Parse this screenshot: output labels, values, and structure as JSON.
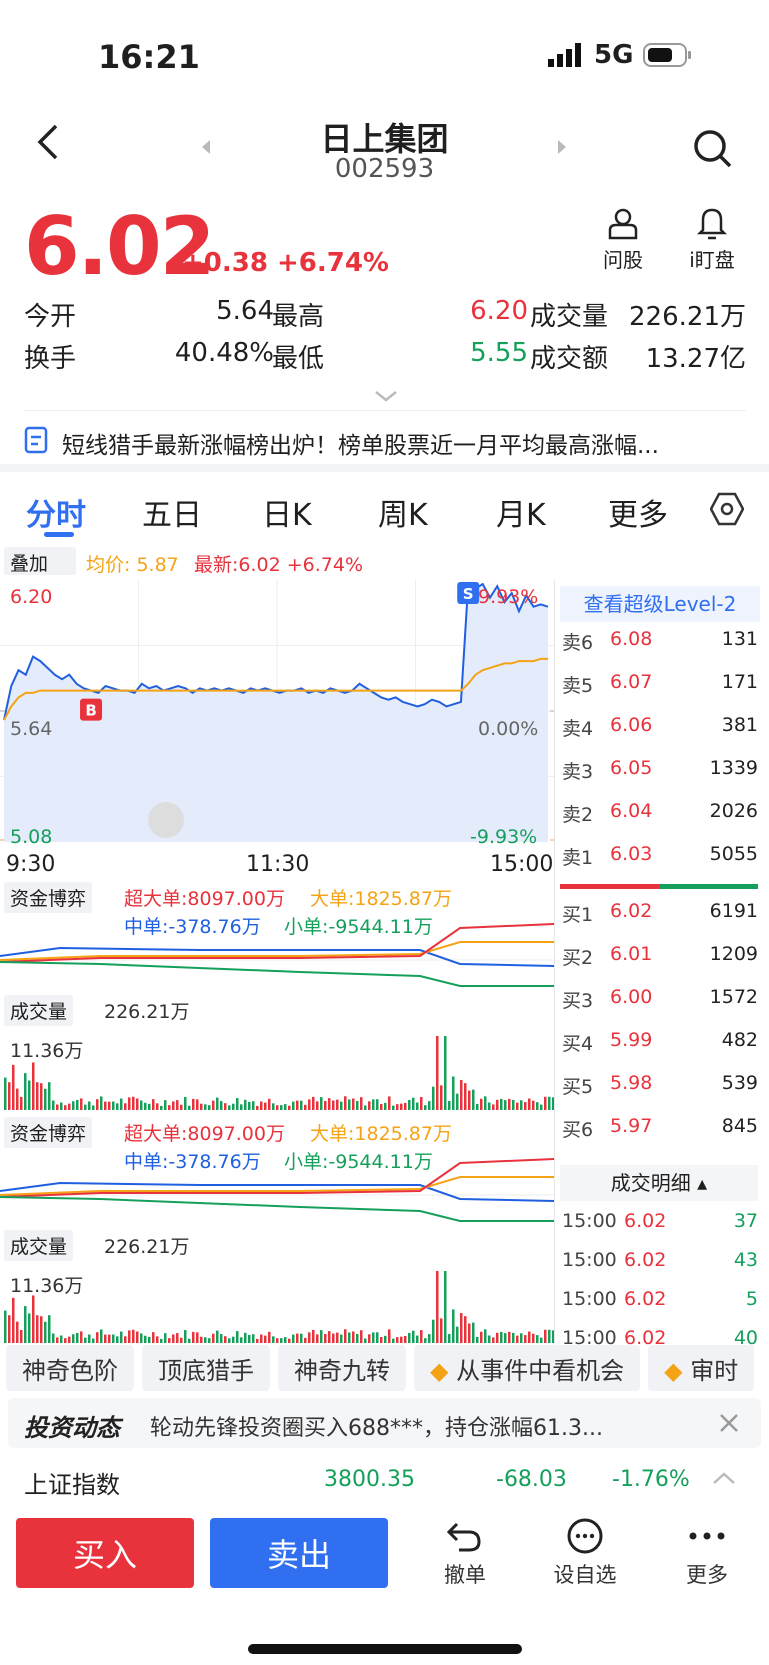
{
  "status": {
    "time": "16:21",
    "network": "5G"
  },
  "header": {
    "title": "日上集团",
    "code": "002593"
  },
  "quote": {
    "price": "6.02",
    "change": "+0.38",
    "change_pct": "+6.74%",
    "actions": [
      {
        "label": "问股",
        "icon": "person-icon"
      },
      {
        "label": "i盯盘",
        "icon": "bell-icon"
      }
    ],
    "rows": [
      [
        {
          "label": "今开",
          "value": "5.64"
        },
        {
          "label": "最高",
          "value": "6.20"
        },
        {
          "label": "成交量",
          "value": "226.21万"
        }
      ],
      [
        {
          "label": "换手",
          "value": "40.48%"
        },
        {
          "label": "最低",
          "value": "5.55"
        },
        {
          "label": "成交额",
          "value": "13.27亿"
        }
      ]
    ]
  },
  "news": "短线猎手最新涨幅榜出炉！榜单股票近一月平均最高涨幅...",
  "tabs": [
    "分时",
    "五日",
    "日K",
    "周K",
    "月K",
    "更多"
  ],
  "chart_header": {
    "overlay": "叠加",
    "avg": "均价: 5.87",
    "latest": "最新:6.02 +6.74%"
  },
  "chart_data": {
    "type": "line",
    "x_ticks": [
      "9:30",
      "11:30",
      "15:00"
    ],
    "y_left": [
      "6.20",
      "5.64",
      "5.08"
    ],
    "y_right": [
      "9.93%",
      "0.00%",
      "-9.93%"
    ],
    "ylim": [
      5.08,
      6.2
    ],
    "series": [
      {
        "name": "最新",
        "values": [
          5.6,
          5.75,
          5.82,
          5.8,
          5.88,
          5.86,
          5.83,
          5.8,
          5.78,
          5.8,
          5.76,
          5.74,
          5.73,
          5.72,
          5.75,
          5.74,
          5.73,
          5.73,
          5.72,
          5.76,
          5.74,
          5.75,
          5.73,
          5.74,
          5.75,
          5.74,
          5.72,
          5.74,
          5.73,
          5.74,
          5.73,
          5.74,
          5.73,
          5.72,
          5.74,
          5.73,
          5.74,
          5.73,
          5.72,
          5.73,
          5.73,
          5.74,
          5.72,
          5.73,
          5.72,
          5.74,
          5.73,
          5.72,
          5.73,
          5.76,
          5.74,
          5.72,
          5.7,
          5.69,
          5.7,
          5.68,
          5.67,
          5.66,
          5.67,
          5.69,
          5.68,
          5.66,
          5.67,
          5.68,
          6.2,
          6.18,
          6.2,
          6.14,
          6.19,
          6.12,
          6.16,
          6.08,
          6.15,
          6.1,
          6.11,
          6.1
        ]
      },
      {
        "name": "均价",
        "values": [
          5.6,
          5.66,
          5.7,
          5.72,
          5.72,
          5.73,
          5.73,
          5.73,
          5.73,
          5.73,
          5.73,
          5.73,
          5.73,
          5.73,
          5.73,
          5.73,
          5.73,
          5.73,
          5.73,
          5.73,
          5.73,
          5.73,
          5.73,
          5.73,
          5.73,
          5.73,
          5.73,
          5.73,
          5.73,
          5.73,
          5.73,
          5.73,
          5.73,
          5.73,
          5.73,
          5.73,
          5.73,
          5.73,
          5.73,
          5.73,
          5.73,
          5.73,
          5.73,
          5.73,
          5.73,
          5.73,
          5.73,
          5.73,
          5.73,
          5.73,
          5.73,
          5.73,
          5.73,
          5.73,
          5.73,
          5.73,
          5.73,
          5.73,
          5.73,
          5.73,
          5.73,
          5.73,
          5.73,
          5.73,
          5.76,
          5.8,
          5.82,
          5.83,
          5.84,
          5.85,
          5.85,
          5.86,
          5.86,
          5.86,
          5.87,
          5.87
        ]
      }
    ],
    "markers": [
      "B",
      "S"
    ]
  },
  "capital": {
    "title": "资金博弈",
    "super": "超大单:8097.00万",
    "big": "大单:1825.87万",
    "mid": "中单:-378.76万",
    "small": "小单:-9544.11万"
  },
  "volume": {
    "title": "成交量",
    "total": "226.21万",
    "max": "11.36万"
  },
  "orderbook": {
    "level2": "查看超级Level-2",
    "asks": [
      {
        "label": "卖6",
        "price": "6.08",
        "vol": "131"
      },
      {
        "label": "卖5",
        "price": "6.07",
        "vol": "171"
      },
      {
        "label": "卖4",
        "price": "6.06",
        "vol": "381"
      },
      {
        "label": "卖3",
        "price": "6.05",
        "vol": "1339"
      },
      {
        "label": "卖2",
        "price": "6.04",
        "vol": "2026"
      },
      {
        "label": "卖1",
        "price": "6.03",
        "vol": "5055"
      }
    ],
    "bids": [
      {
        "label": "买1",
        "price": "6.02",
        "vol": "6191"
      },
      {
        "label": "买2",
        "price": "6.01",
        "vol": "1209"
      },
      {
        "label": "买3",
        "price": "6.00",
        "vol": "1572"
      },
      {
        "label": "买4",
        "price": "5.99",
        "vol": "482"
      },
      {
        "label": "买5",
        "price": "5.98",
        "vol": "539"
      },
      {
        "label": "买6",
        "price": "5.97",
        "vol": "845"
      }
    ],
    "detail_title": "成交明细",
    "trades": [
      {
        "time": "15:00",
        "price": "6.02",
        "vol": "37"
      },
      {
        "time": "15:00",
        "price": "6.02",
        "vol": "43"
      },
      {
        "time": "15:00",
        "price": "6.02",
        "vol": "5"
      },
      {
        "time": "15:00",
        "price": "6.02",
        "vol": "40"
      }
    ]
  },
  "features": [
    "神奇色阶",
    "顶底猎手",
    "神奇九转",
    "从事件中看机会",
    "审时"
  ],
  "dynamic": {
    "brand": "投资动态",
    "text": "轮动先锋投资圈买入688***，持仓涨幅61.3..."
  },
  "index": {
    "name": "上证指数",
    "value": "3800.35",
    "change": "-68.03",
    "pct": "-1.76%"
  },
  "bottom": {
    "buy": "买入",
    "sell": "卖出",
    "items": [
      "撤单",
      "设自选",
      "更多"
    ]
  }
}
